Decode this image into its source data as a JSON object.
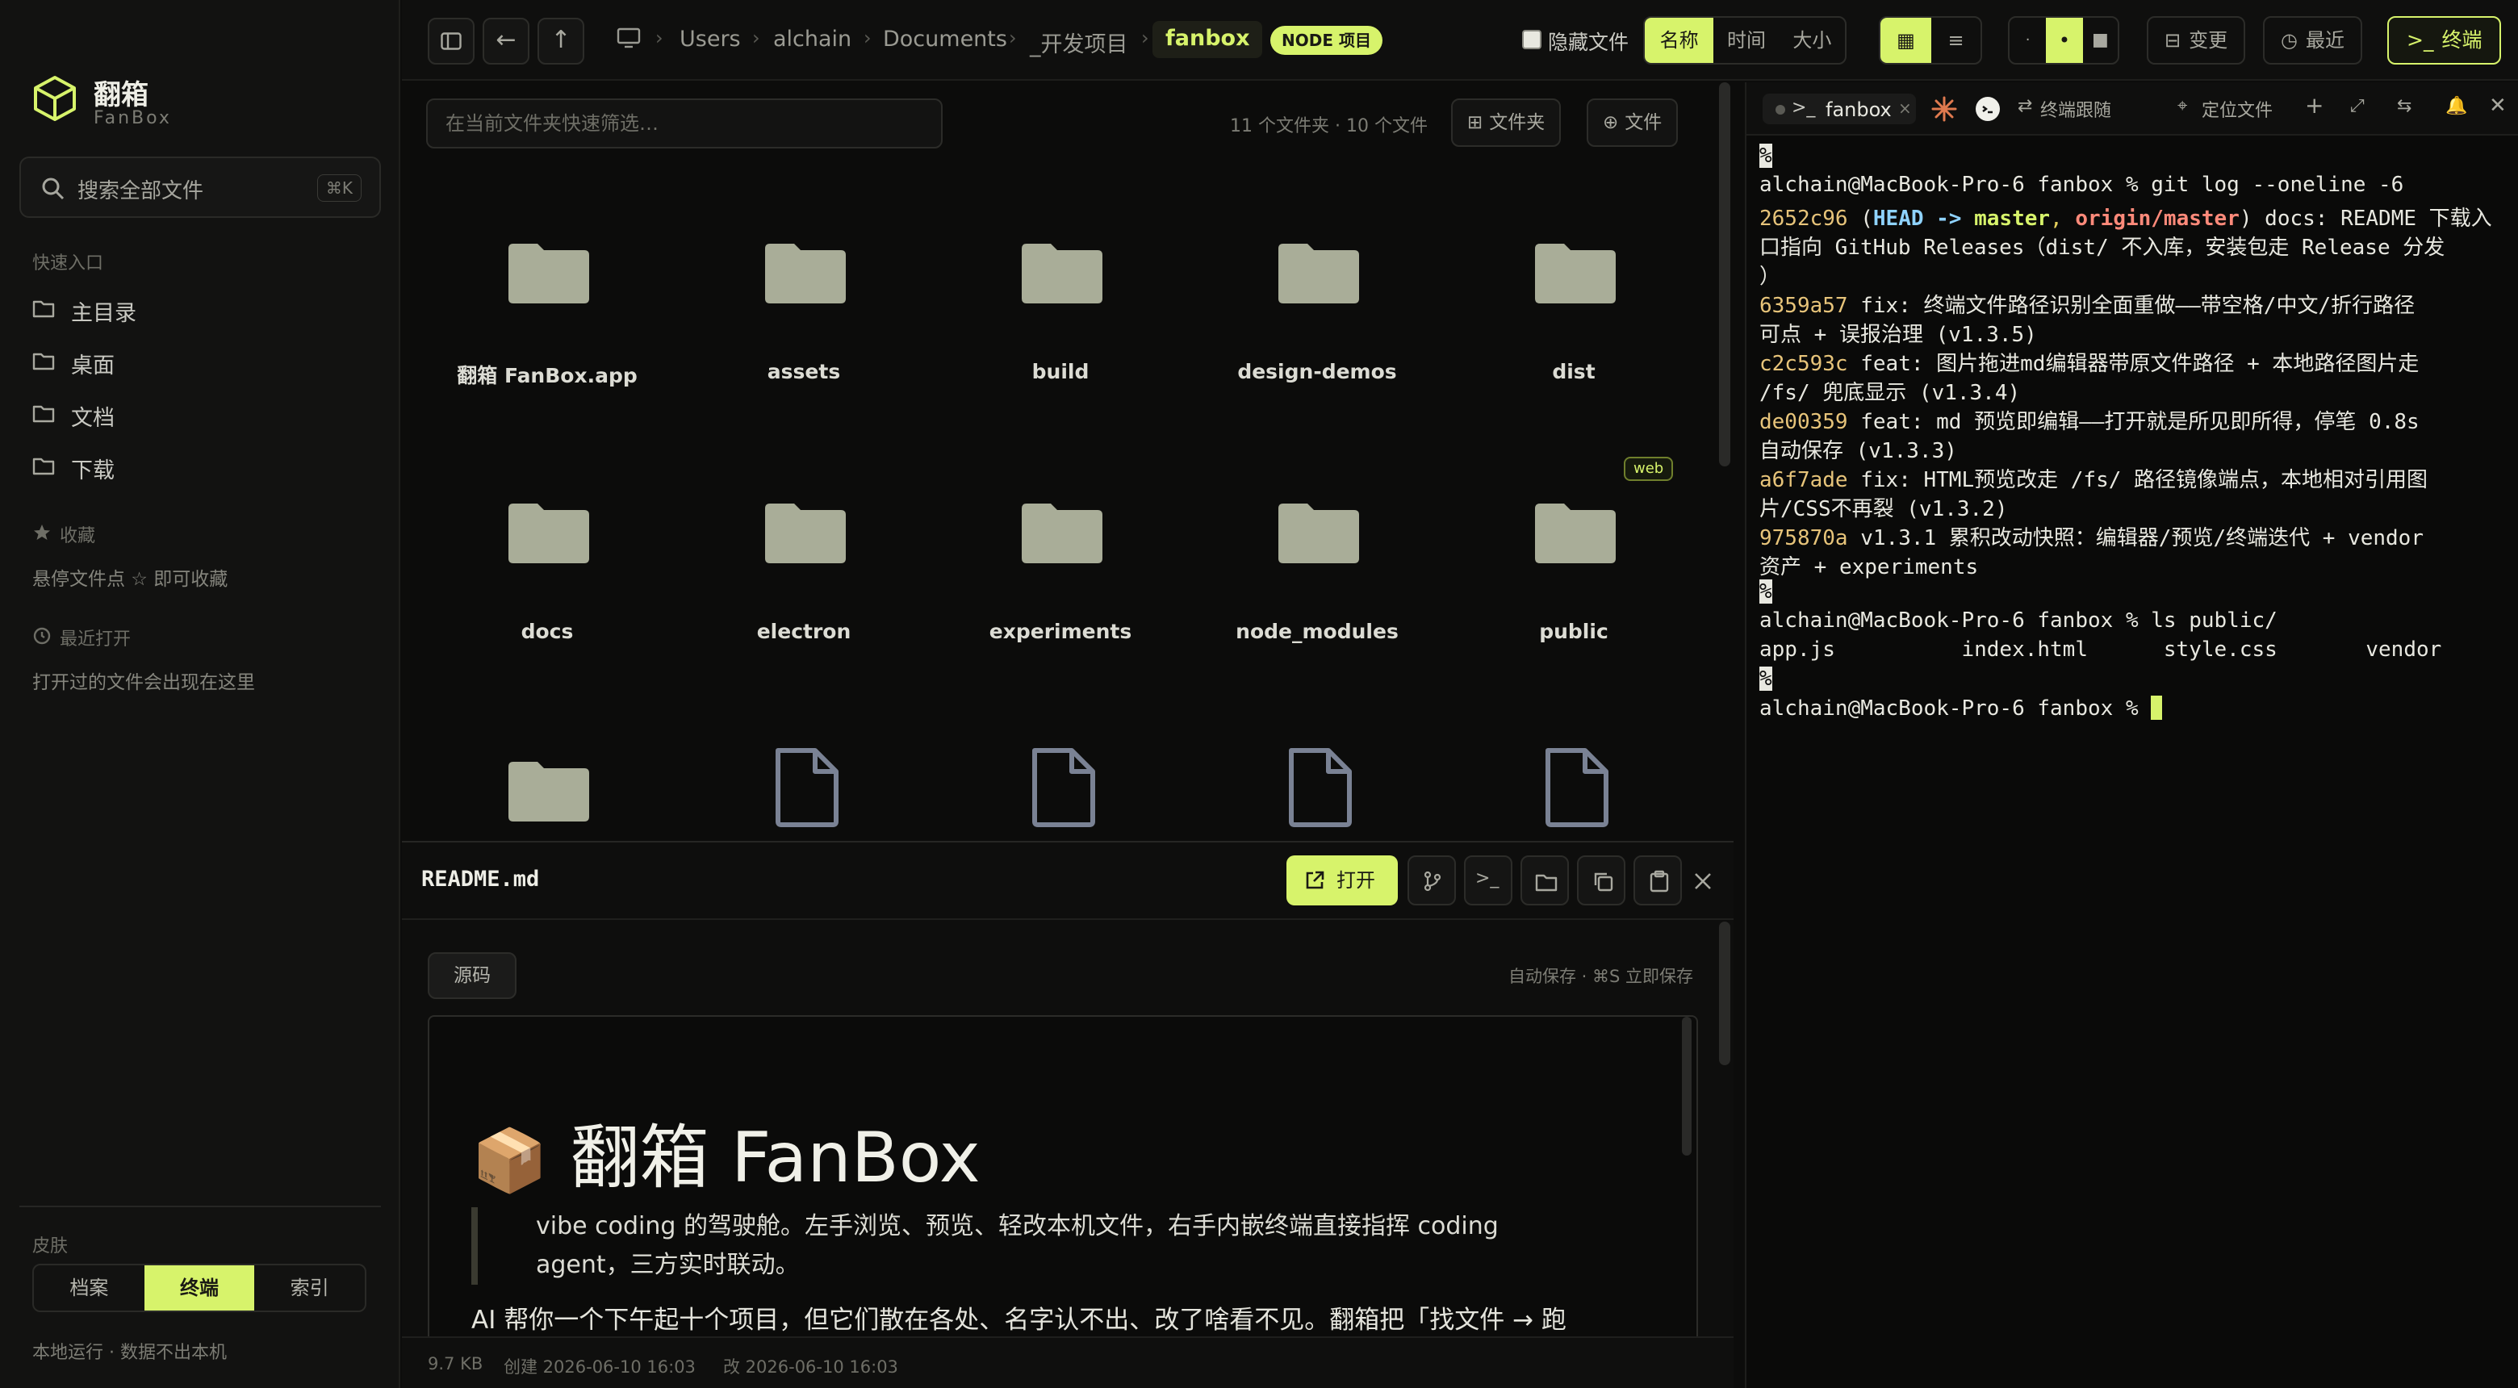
{
  "sidebar": {
    "app_name": "翻箱",
    "app_sub": "FanBox",
    "search_placeholder": "搜索全部文件",
    "search_kbd": "⌘K",
    "quick_label": "快速入口",
    "quick_items": [
      "主目录",
      "桌面",
      "文档",
      "下载"
    ],
    "fav_label": "收藏",
    "fav_hint": "悬停文件点 ☆ 即可收藏",
    "recent_label": "最近打开",
    "recent_hint": "打开过的文件会出现在这里",
    "skin_label": "皮肤",
    "skins": [
      "档案",
      "终端",
      "索引"
    ],
    "active_skin": "终端",
    "footer": "本地运行 · 数据不出本机"
  },
  "topbar": {
    "breadcrumb": [
      "Users",
      "alchain",
      "Documents",
      "_开发项目"
    ],
    "current": "fanbox",
    "badge": "NODE 项目",
    "hidden_files_label": "隐藏文件",
    "sort": [
      "名称",
      "时间",
      "大小"
    ],
    "active_sort": "名称",
    "changes_label": "变更",
    "recent_label": "最近",
    "terminal_label": "终端"
  },
  "browser": {
    "filter_placeholder": "在当前文件夹快速筛选…",
    "counts": "11 个文件夹 · 10 个文件",
    "new_folder_label": "文件夹",
    "new_file_label": "文件",
    "row1": [
      "翻箱 FanBox.app",
      "assets",
      "build",
      "design-demos",
      "dist"
    ],
    "row2": [
      "docs",
      "electron",
      "experiments",
      "node_modules",
      "public"
    ],
    "web_tag": "web"
  },
  "preview": {
    "filename": "README.md",
    "open_label": "打开",
    "source_tab": "源码",
    "autosave": "自动保存 · ⌘S 立即保存",
    "h1_emoji": "📦",
    "h1": "翻箱 FanBox",
    "quote": "vibe coding 的驾驶舱。左手浏览、预览、轻改本机文件，右手内嵌终端直接指挥 coding agent，三方实时联动。",
    "para": "AI 帮你一个下午起十个项目，但它们散在各处、名字认不出、改了啥看不见。翻箱把「找文件 → 跑",
    "size": "9.7 KB",
    "created": "创建 2026-06-10 16:03",
    "modified": "改 2026-06-10 16:03"
  },
  "terminal": {
    "tab_name": "fanbox",
    "follow_label": "终端跟随",
    "locate_label": "定位文件",
    "prompt": "alchain@MacBook-Pro-6 fanbox % ",
    "cmd1": "git log --oneline -6",
    "commits": [
      {
        "hash": "2652c96",
        "text": "docs: README 下载入"
      },
      {
        "text": "口指向 GitHub Releases（dist/ 不入库，安装包走 Release 分发"
      },
      {
        "text": "）"
      },
      {
        "hash": "6359a57",
        "text": " fix: 终端文件路径识别全面重做——带空格/中文/折行路径"
      },
      {
        "text": "可点 + 误报治理 (v1.3.5)"
      },
      {
        "hash": "c2c593c",
        "text": " feat: 图片拖进md编辑器带原文件路径 + 本地路径图片走"
      },
      {
        "text": "/fs/ 兜底显示 (v1.3.4)"
      },
      {
        "hash": "de00359",
        "text": " feat: md 预览即编辑——打开就是所见即所得，停笔 0.8s"
      },
      {
        "text": "自动保存 (v1.3.3)"
      },
      {
        "hash": "a6f7ade",
        "text": " fix: HTML预览改走 /fs/ 路径镜像端点，本地相对引用图"
      },
      {
        "text": "片/CSS不再裂 (v1.3.2)"
      },
      {
        "hash": "975870a",
        "text": " v1.3.1 累积改动快照：编辑器/预览/终端迭代 + vendor"
      },
      {
        "text": "资产 + experiments"
      }
    ],
    "head_ref": "HEAD -> master, origin/master",
    "cmd2": "ls public/",
    "ls_out": "app.js          index.html      style.css       vendor"
  },
  "colors": {
    "accent": "#d7f36b",
    "folder": "#a9ad98",
    "bg": "#0c0c0b"
  }
}
